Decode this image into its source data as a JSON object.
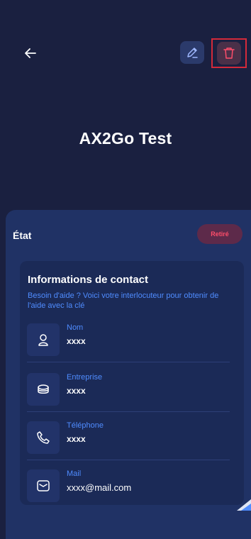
{
  "header": {
    "title": "AX2Go Test",
    "back_icon": "arrow-left-icon",
    "edit_icon": "pencil-icon",
    "delete_icon": "trash-icon"
  },
  "state": {
    "label": "État",
    "badge": "Retiré"
  },
  "contact": {
    "title": "Informations de contact",
    "subtitle": "Besoin d'aide ? Voici votre interlocuteur pour obtenir de l'aide avec la clé",
    "rows": [
      {
        "icon": "user-icon",
        "label": "Nom",
        "value": "xxxx"
      },
      {
        "icon": "building-icon",
        "label": "Entreprise",
        "value": "xxxx"
      },
      {
        "icon": "phone-icon",
        "label": "Téléphone",
        "value": "xxxx"
      },
      {
        "icon": "mail-icon",
        "label": "Mail",
        "value": "xxxx@mail.com"
      }
    ]
  },
  "colors": {
    "background": "#1a2040",
    "sheet": "#203265",
    "card": "#1b2a57",
    "accent_blue": "#4f8cff",
    "danger": "#ff4d6a",
    "highlight_border": "#d42a3a"
  }
}
